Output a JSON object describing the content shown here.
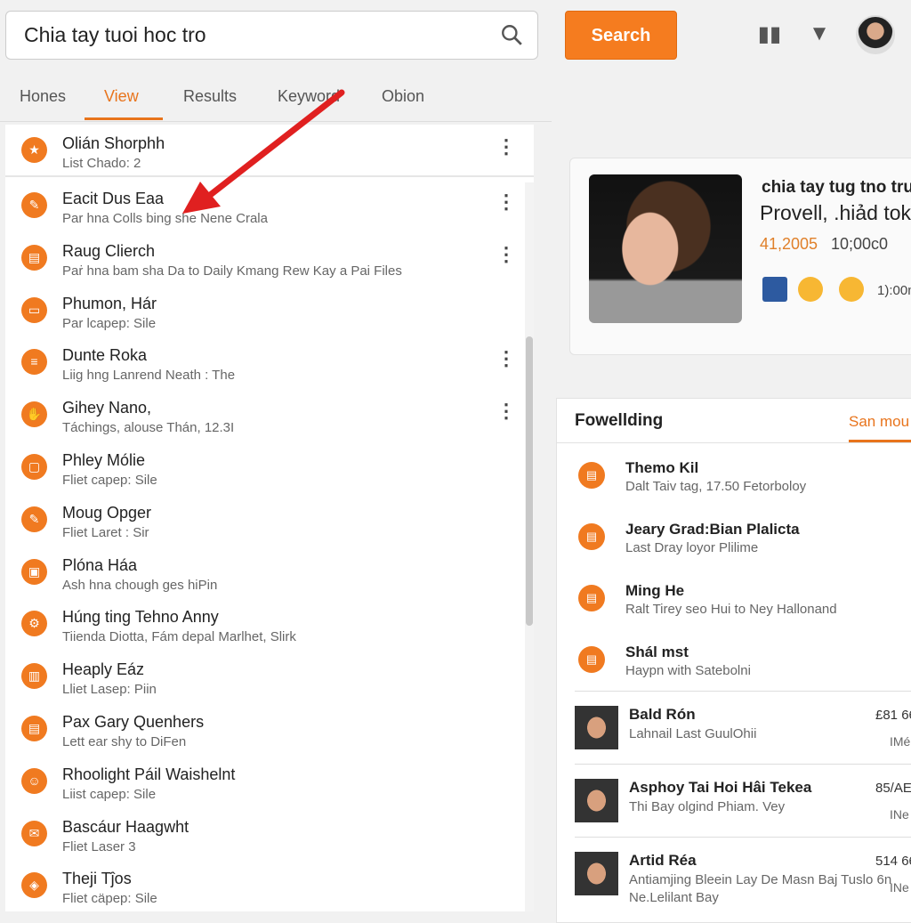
{
  "search": {
    "value": "Chia tay tuoi hoc tro",
    "button": "Search"
  },
  "colors": {
    "accent": "#f57c1f",
    "arrow": "#e02020"
  },
  "tabs": [
    {
      "label": "Hones"
    },
    {
      "label": "View",
      "active": true
    },
    {
      "label": "Results"
    },
    {
      "label": "Keyword"
    },
    {
      "label": "Obion"
    }
  ],
  "list": [
    {
      "title": "Olián Shorphh",
      "sub": "List Chado: 2",
      "icon": "star-icon",
      "menu": true
    },
    {
      "title": "Eacit Dus Eaa",
      "sub": "Par hna Colls bing she Nene Crala",
      "icon": "pencil-icon",
      "menu": true
    },
    {
      "title": "Raug Clierch",
      "sub": "Paṙ hna bam sha Da to Daily Kmang Rew Kay a Pai Files",
      "icon": "folder-icon",
      "menu": true
    },
    {
      "title": "Phumon, Hár",
      "sub": "Par lcapep: Sile",
      "icon": "window-icon",
      "menu": false
    },
    {
      "title": "Dunte Roka",
      "sub": "Liig hng Lanrend Neath : The",
      "icon": "list-icon",
      "menu": true
    },
    {
      "title": "Gihey Nano,",
      "sub": "Táchings, alouse Thán, 12.3I",
      "icon": "hand-icon",
      "menu": true
    },
    {
      "title": "Phley Mólie",
      "sub": "Fliet capep: Sile",
      "icon": "box-icon",
      "menu": false
    },
    {
      "title": "Moug Opger",
      "sub": "Fliet Laret : Sir",
      "icon": "pencil-icon",
      "menu": false
    },
    {
      "title": "Plóna Háa",
      "sub": "Ash hna chough ges hiPin",
      "icon": "car-icon",
      "menu": false
    },
    {
      "title": "Húng ting Tehno Anny",
      "sub": "Tiienda Diotta, Fám depal Marlhet, Slirk",
      "icon": "gear-icon",
      "menu": false
    },
    {
      "title": "Heaply Eáz",
      "sub": "Lliet Lasep: Piin",
      "icon": "bus-icon",
      "menu": false
    },
    {
      "title": "Pax Gary Quenhers",
      "sub": "Lett ear shy to DiFen",
      "icon": "folder-icon",
      "menu": false
    },
    {
      "title": "Rhoolight Páil Waishelnt",
      "sub": "Liist capep: Sile",
      "icon": "people-icon",
      "menu": false
    },
    {
      "title": "Bascáur Haagwht",
      "sub": "Fliet Laser 3",
      "icon": "mail-icon",
      "menu": false
    },
    {
      "title": "Theji Tĵos",
      "sub": "Fliet cäpep: Sile",
      "icon": "bag-icon",
      "menu": false
    }
  ],
  "card": {
    "title": "chia tay tug tno tru",
    "subtitle": "Provell, .hiảd tok",
    "count": "41,2005",
    "date": "10;00c0",
    "time": "1):00m"
  },
  "following": {
    "header": "Fowellding",
    "tab": "San mou",
    "items": [
      {
        "title": "Themo Kil",
        "sub": "Dalt Taiv tag, 17.50 Fetorboloy"
      },
      {
        "title": "Jeary Grad:Bian Plalicta",
        "sub": "Last Dray loyor Plilime"
      },
      {
        "title": "Ming He",
        "sub": "Ralt Tirey seo Hui to Ney Hallonand"
      },
      {
        "title": "Shál mst",
        "sub": "Haypn with Satebolni"
      }
    ],
    "people": [
      {
        "name": "Bald Rón",
        "sub": "Lahnail Last GuulOhii",
        "value": "£81 66",
        "note": "IMé"
      },
      {
        "name": "Asphoy Tai Hoi Hâi Tekea",
        "sub": "Thi Bay olgind Phiam. Vey",
        "value": "85/AE",
        "note": "INe"
      },
      {
        "name": "Artid Réa",
        "sub": "Antiamjing Bleein Lay De Masn Baj Tuslo 6n Ne.Lelilant Bay",
        "value": "514 66",
        "note": "INe"
      }
    ]
  }
}
